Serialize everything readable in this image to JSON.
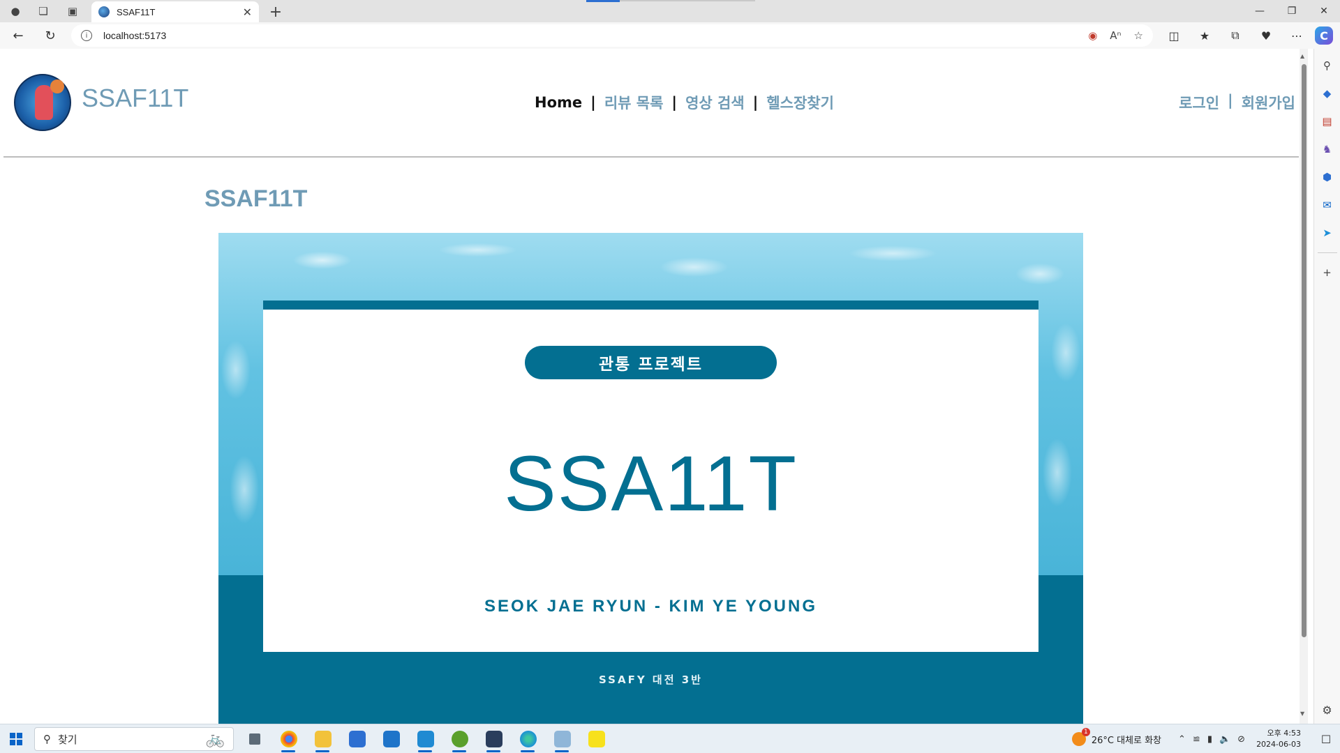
{
  "browser": {
    "tab_title": "SSAF11T",
    "url": "localhost:5173"
  },
  "site": {
    "brand": "SSAF11T",
    "nav": {
      "home": "Home",
      "reviews": "리뷰 목록",
      "video_search": "영상 검색",
      "gym_finder": "헬스장찾기",
      "separator": "|"
    },
    "auth": {
      "login": "로그인",
      "separator": "|",
      "signup": "회원가입"
    },
    "section_title": "SSAF11T",
    "banner": {
      "pill": "관통 프로젝트",
      "title": "SSA11T",
      "names": "SEOK JAE RYUN - KIM YE YOUNG",
      "footer": "SSAFY 대전 3반"
    }
  },
  "taskbar": {
    "search_placeholder": "찾기",
    "weather": "26°C 대체로 화창",
    "weather_badge": "1",
    "time_period": "오후 4:53",
    "date": "2024-06-03"
  },
  "colors": {
    "accent_teal": "#036f91",
    "brand_blue": "#6f9bb5",
    "nav_active": "#111111"
  }
}
